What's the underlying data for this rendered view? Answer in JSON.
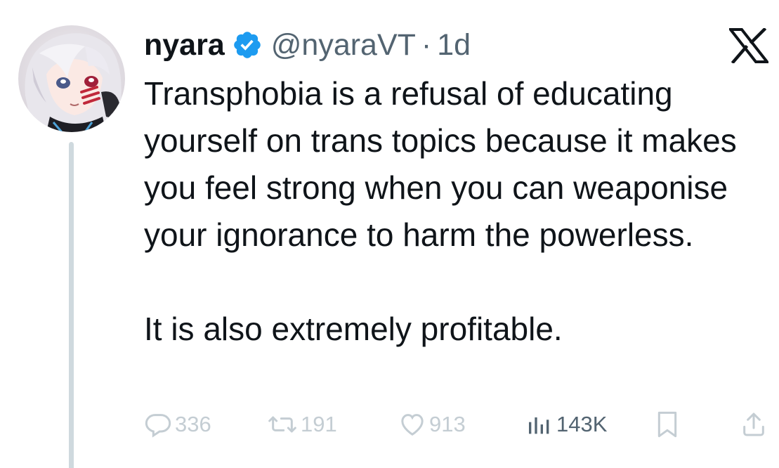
{
  "tweet": {
    "author_name": "nyara",
    "handle": "@nyaraVT",
    "separator": "·",
    "age": "1d",
    "body_paragraphs": [
      "Transphobia is a refusal of educating yourself on trans topics because it makes you feel strong when you can weaponise your ignorance to harm the powerless.",
      "It is also extremely profitable."
    ],
    "stats": {
      "replies": "336",
      "reposts": "191",
      "likes": "913",
      "views": "143K"
    }
  },
  "icons": {
    "verified": "verified-badge-icon",
    "logo": "x-logo-icon",
    "reply": "reply-icon",
    "repost": "repost-icon",
    "like": "heart-icon",
    "views": "views-chart-icon",
    "bookmark": "bookmark-icon",
    "share": "share-icon"
  },
  "colors": {
    "verified_blue": "#1d9bf0",
    "text_primary": "#0f1419",
    "text_secondary": "#536471",
    "faded_action": "#c4cdd3",
    "thread_line": "#cfd9de"
  }
}
